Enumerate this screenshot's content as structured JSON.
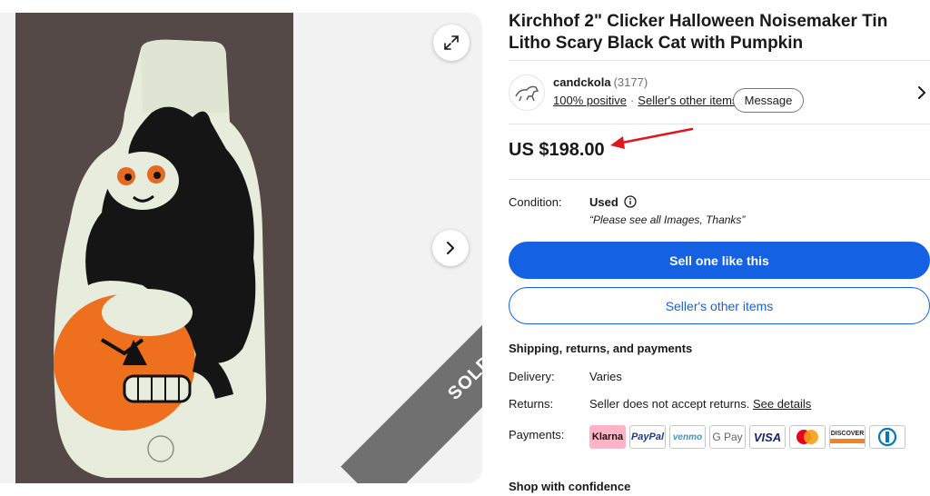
{
  "listing": {
    "title": "Kirchhof 2\" Clicker Halloween Noisemaker Tin Litho Scary Black Cat with Pumpkin",
    "sold_badge": "SOLD",
    "price": "US $198.00"
  },
  "seller": {
    "name": "candckola",
    "feedback_count": "(3177)",
    "positive": "100% positive",
    "other_items_link": "Seller's other items",
    "message_button": "Message"
  },
  "condition": {
    "label": "Condition:",
    "value": "Used",
    "note": "“Please see all Images, Thanks”"
  },
  "actions": {
    "sell_one_like_this": "Sell one like this",
    "sellers_other_items": "Seller's other items"
  },
  "shipping": {
    "heading": "Shipping, returns, and payments",
    "delivery_label": "Delivery:",
    "delivery_value": "Varies",
    "returns_label": "Returns:",
    "returns_value": "Seller does not accept returns.",
    "returns_link": "See details",
    "payments_label": "Payments:",
    "payment_methods": [
      "Klarna",
      "PayPal",
      "venmo",
      "G Pay",
      "VISA",
      "Mastercard",
      "DISCOVER",
      "Diners Club"
    ]
  },
  "shop_with_confidence": "Shop with confidence",
  "colors": {
    "primary_blue": "#1461e3",
    "annotation_red": "#e0161e",
    "sold_gray": "#707070"
  },
  "icons": [
    "expand-icon",
    "chevron-right-icon",
    "info-icon",
    "next-arrow-icon"
  ]
}
